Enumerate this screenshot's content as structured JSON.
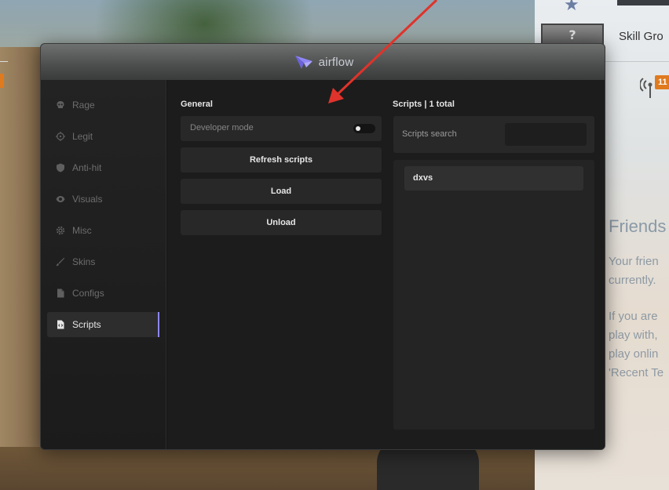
{
  "app": {
    "title": "airflow",
    "accent_color": "#8f86f5"
  },
  "sidebar": {
    "items": [
      {
        "label": "Rage",
        "icon": "skull-icon",
        "active": false
      },
      {
        "label": "Legit",
        "icon": "crosshair-icon",
        "active": false
      },
      {
        "label": "Anti-hit",
        "icon": "shield-icon",
        "active": false
      },
      {
        "label": "Visuals",
        "icon": "eye-icon",
        "active": false
      },
      {
        "label": "Misc",
        "icon": "gear-icon",
        "active": false
      },
      {
        "label": "Skins",
        "icon": "brush-icon",
        "active": false
      },
      {
        "label": "Configs",
        "icon": "document-icon",
        "active": false
      },
      {
        "label": "Scripts",
        "icon": "script-file-icon",
        "active": true
      }
    ]
  },
  "general": {
    "title": "General",
    "developer_mode_label": "Developer mode",
    "developer_mode_enabled": false,
    "refresh_label": "Refresh scripts",
    "load_label": "Load",
    "unload_label": "Unload"
  },
  "scripts": {
    "title": "Scripts | 1 total",
    "search_label": "Scripts search",
    "search_value": "",
    "items": [
      "dxvs"
    ]
  },
  "background": {
    "rank_glyph": "?",
    "skill_label": "Skill Gro",
    "notification_count": "11",
    "friends_title": "Friends",
    "friends_lines": [
      "Your frien",
      "currently.",
      "",
      "If you are",
      "play with,",
      "play onlin",
      "'Recent Te"
    ]
  }
}
